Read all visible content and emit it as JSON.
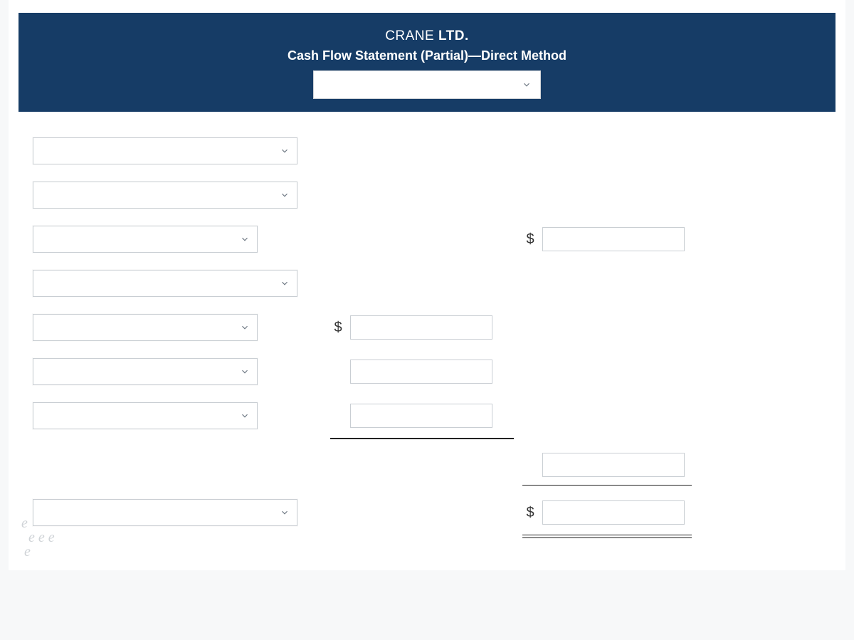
{
  "header": {
    "company_prefix": "CRANE ",
    "company_suffix": "LTD.",
    "subtitle": "Cash Flow Statement (Partial)—Direct Method",
    "period_select_value": ""
  },
  "rows": {
    "r1": {
      "label": ""
    },
    "r2": {
      "label": ""
    },
    "r3": {
      "label": "",
      "amount_right_currency": "$",
      "amount_right": ""
    },
    "r4": {
      "label": ""
    },
    "r5": {
      "label": "",
      "amount_mid_currency": "$",
      "amount_mid": ""
    },
    "r6": {
      "label": "",
      "amount_mid": ""
    },
    "r7": {
      "label": "",
      "amount_mid": ""
    },
    "r8_subtotal": {
      "amount_right": ""
    },
    "r9": {
      "label": "",
      "amount_right_currency": "$",
      "amount_right": ""
    }
  },
  "watermark": {
    "l1": "e",
    "l2": "e  e  e",
    "l3": "e"
  }
}
